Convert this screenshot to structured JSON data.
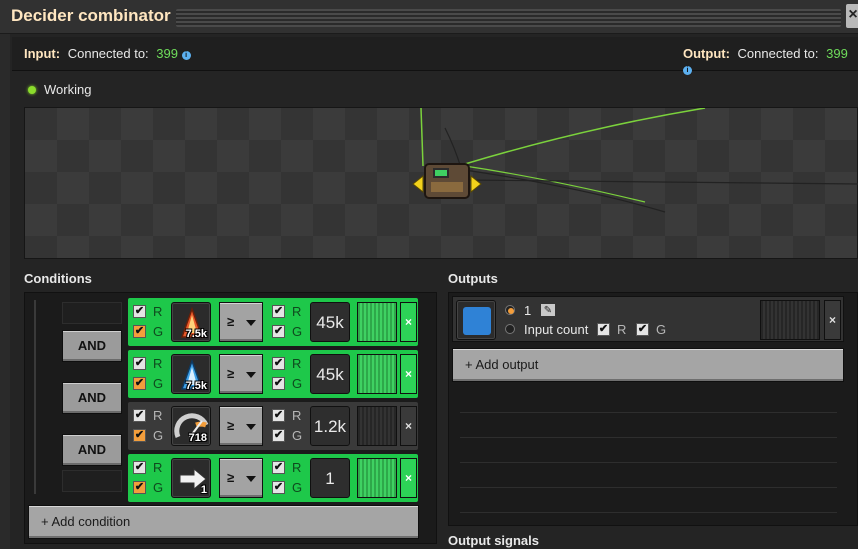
{
  "window": {
    "title": "Decider combinator",
    "close_glyph": "×"
  },
  "input": {
    "label": "Input:",
    "connected_label": "Connected to:",
    "count": "399"
  },
  "output": {
    "label": "Output:",
    "connected_label": "Connected to:",
    "count": "399"
  },
  "status": {
    "text": "Working",
    "color": "#8bdc2c"
  },
  "conditions": {
    "header": "Conditions",
    "and_label": "AND",
    "add_label": "+ Add condition",
    "rows": [
      {
        "active": true,
        "left_r": true,
        "left_g": true,
        "signal_icon": "red-science-flask-icon",
        "signal_count": "7.5k",
        "comparator": "≥",
        "right_r": true,
        "right_g": true,
        "value": "45k"
      },
      {
        "active": true,
        "left_r": true,
        "left_g": true,
        "signal_icon": "blue-science-flask-icon",
        "signal_count": "7.5k",
        "comparator": "≥",
        "right_r": true,
        "right_g": true,
        "value": "45k"
      },
      {
        "active": false,
        "left_r": true,
        "left_g": true,
        "signal_icon": "speed-gauge-icon",
        "signal_count": "718",
        "comparator": "≥",
        "right_r": true,
        "right_g": true,
        "value": "1.2k"
      },
      {
        "active": true,
        "left_r": true,
        "left_g": true,
        "signal_icon": "arrow-right-icon",
        "signal_count": "1",
        "comparator": "≥",
        "right_r": true,
        "right_g": true,
        "value": "1"
      }
    ]
  },
  "outputs": {
    "header": "Outputs",
    "add_label": "+ Add output",
    "signal_icon": "blue-square-signal-icon",
    "constant_value": "1",
    "input_count_label": "Input count",
    "r_label": "R",
    "g_label": "G"
  },
  "output_signals": {
    "header": "Output signals"
  },
  "labels": {
    "r": "R",
    "g": "G",
    "check": "✔",
    "x": "×"
  }
}
